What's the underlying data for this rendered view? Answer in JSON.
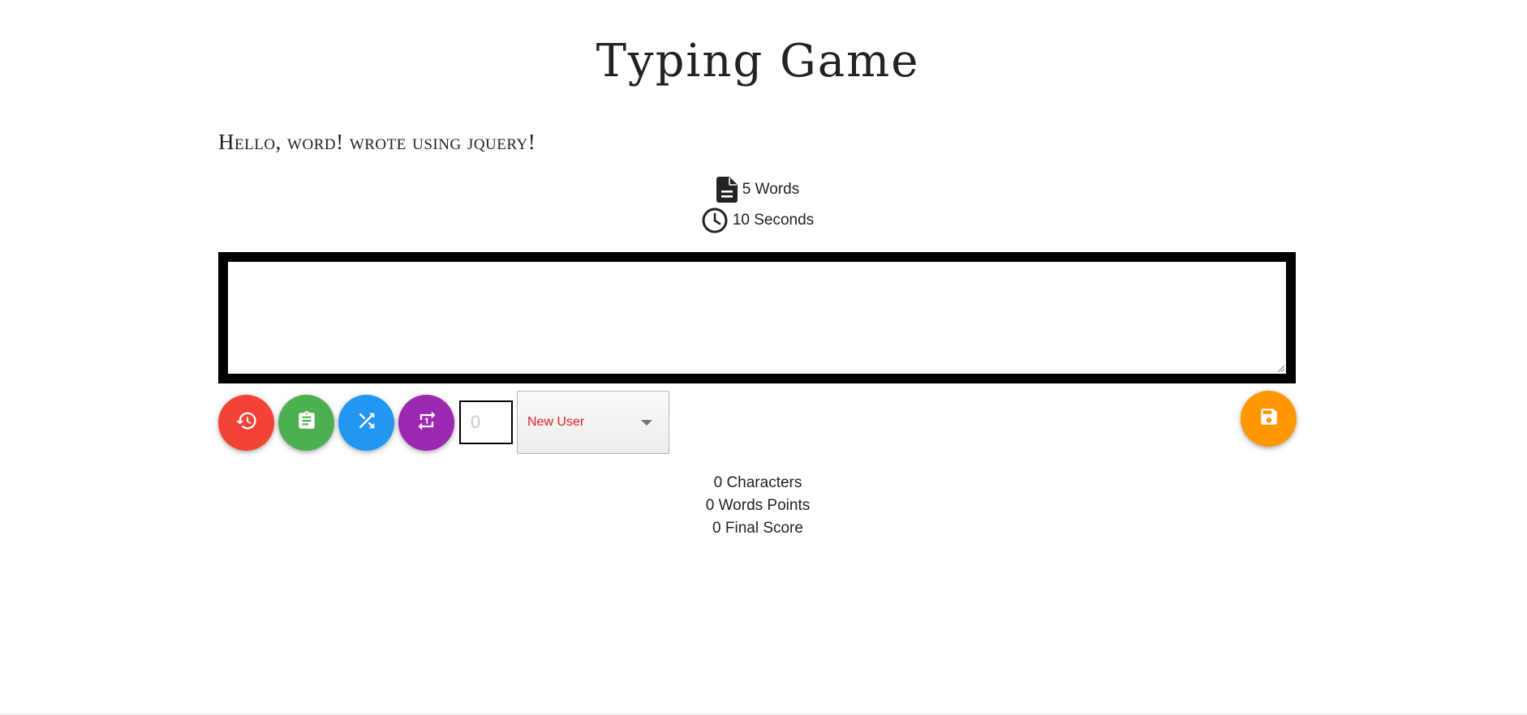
{
  "app": {
    "title": "Typing Game"
  },
  "prompt": {
    "sentence": "Hello, word! wrote using jquery!"
  },
  "settings": {
    "word_count_label": "5 Words",
    "time_label": "10 Seconds",
    "word_icon": "document-icon",
    "time_icon": "clock-icon"
  },
  "typing_area": {
    "value": ""
  },
  "toolbar": {
    "buttons": [
      {
        "name": "history-button",
        "icon": "history-icon",
        "color": "#f44336"
      },
      {
        "name": "clipboard-button",
        "icon": "clipboard-icon",
        "color": "#4caf50"
      },
      {
        "name": "shuffle-button",
        "icon": "shuffle-icon",
        "color": "#2196f3"
      },
      {
        "name": "repeat-button",
        "icon": "repeat-icon",
        "color": "#9c27b0"
      }
    ],
    "number_input": {
      "placeholder": "0",
      "value": ""
    },
    "user_select": {
      "selected": "New User",
      "color": "#e0201f"
    },
    "save_button": {
      "icon": "save-icon",
      "color": "#ff9800"
    }
  },
  "results": {
    "characters": "0 Characters",
    "word_points": "0 Words Points",
    "final_score": "0 Final Score"
  }
}
